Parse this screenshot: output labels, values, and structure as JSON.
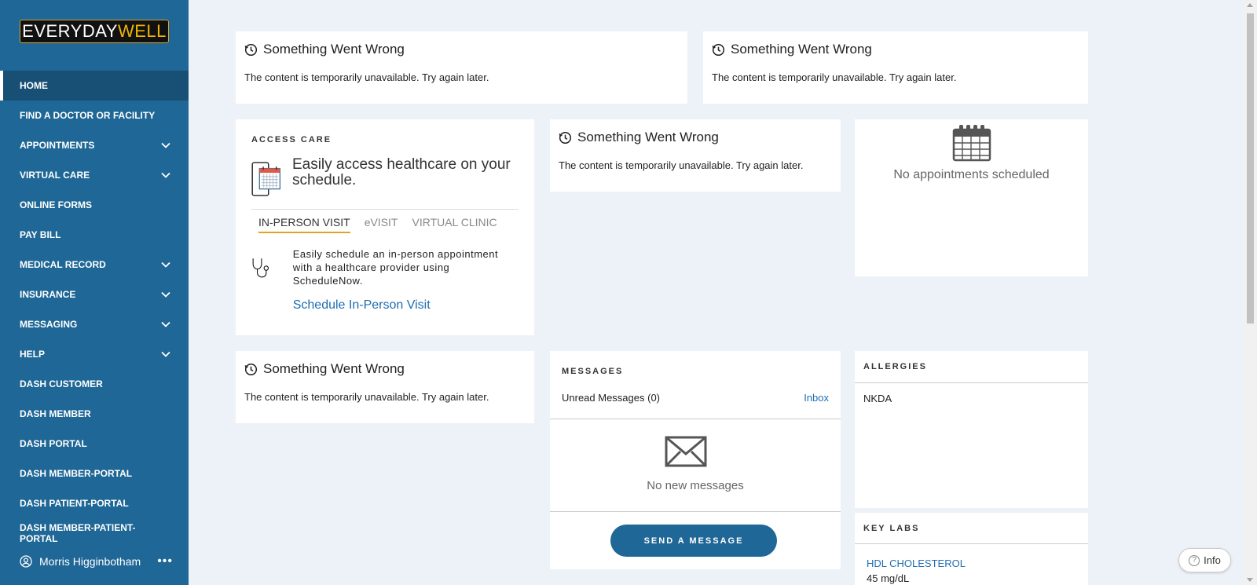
{
  "brand": {
    "logo_part1": "EVERYDAY",
    "logo_part2": "WELL",
    "accent": "#f0b400"
  },
  "sidebar": {
    "items": [
      {
        "label": "HOME",
        "active": true,
        "expandable": false
      },
      {
        "label": "FIND A DOCTOR OR FACILITY",
        "expandable": false
      },
      {
        "label": "APPOINTMENTS",
        "expandable": true
      },
      {
        "label": "VIRTUAL CARE",
        "expandable": true
      },
      {
        "label": "ONLINE FORMS",
        "expandable": false
      },
      {
        "label": "PAY BILL",
        "expandable": false
      },
      {
        "label": "MEDICAL RECORD",
        "expandable": true
      },
      {
        "label": "INSURANCE",
        "expandable": true
      },
      {
        "label": "MESSAGING",
        "expandable": true
      },
      {
        "label": "HELP",
        "expandable": true
      },
      {
        "label": "DASH CUSTOMER",
        "expandable": false
      },
      {
        "label": "DASH MEMBER",
        "expandable": false
      },
      {
        "label": "DASH PORTAL",
        "expandable": false
      },
      {
        "label": "DASH MEMBER-PORTAL",
        "expandable": false
      },
      {
        "label": "DASH PATIENT-PORTAL",
        "expandable": false
      },
      {
        "label": "DASH MEMBER-PATIENT-PORTAL",
        "expandable": false
      }
    ],
    "user_name": "Morris Higginbotham",
    "more": "•••",
    "color": "#1f6796"
  },
  "errors": {
    "title": "Something Went Wrong",
    "body": "The content is temporarily unavailable. Try again later."
  },
  "access_care": {
    "heading": "ACCESS CARE",
    "hero": "Easily access healthcare on your schedule.",
    "tabs": [
      "IN-PERSON VISIT",
      "eVISIT",
      "VIRTUAL CLINIC"
    ],
    "active_tab": "IN-PERSON VISIT",
    "description": "Easily schedule an in-person appointment with a healthcare provider using ScheduleNow.",
    "link": "Schedule In-Person Visit"
  },
  "appointments": {
    "empty_text": "No appointments scheduled"
  },
  "messages": {
    "heading": "MESSAGES",
    "unread_label": "Unread Messages (0)",
    "inbox_link": "Inbox",
    "empty_text": "No new messages",
    "send_button": "SEND A MESSAGE"
  },
  "allergies": {
    "heading": "ALLERGIES",
    "value": "NKDA"
  },
  "key_labs": {
    "heading": "KEY LABS",
    "items": [
      {
        "name": "HDL CHOLESTEROL",
        "value": "45 mg/dL"
      }
    ]
  },
  "info_button": "Info"
}
